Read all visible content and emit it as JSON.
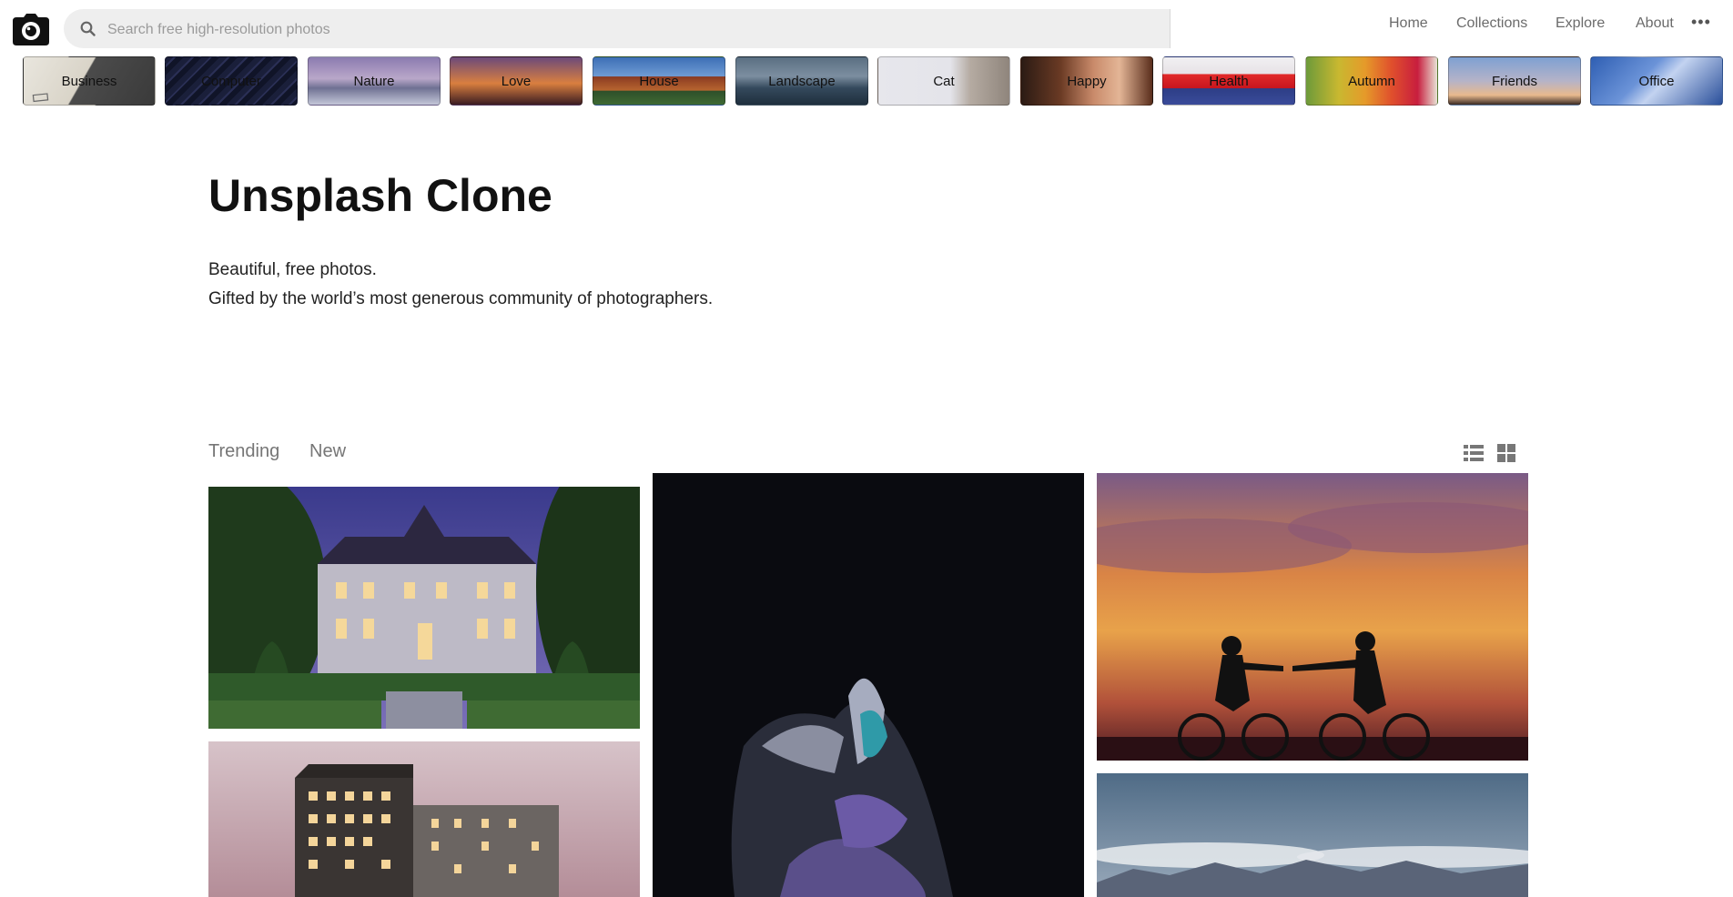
{
  "search": {
    "placeholder": "Search free high-resolution photos"
  },
  "nav": {
    "home": "Home",
    "collections": "Collections",
    "explore": "Explore",
    "about": "About",
    "more": "•••"
  },
  "topics": [
    {
      "label": "Business"
    },
    {
      "label": "Computer"
    },
    {
      "label": "Nature"
    },
    {
      "label": "Love"
    },
    {
      "label": "House"
    },
    {
      "label": "Landscape"
    },
    {
      "label": "Cat"
    },
    {
      "label": "Happy"
    },
    {
      "label": "Health"
    },
    {
      "label": "Autumn"
    },
    {
      "label": "Friends"
    },
    {
      "label": "Office"
    }
  ],
  "hero": {
    "title": "Unsplash Clone",
    "line1": "Beautiful, free photos.",
    "line2": "Gifted by the world’s most generous community of photographers."
  },
  "feed": {
    "tabs": {
      "trending": "Trending",
      "new": "New"
    },
    "view_modes": [
      "list-view-icon",
      "grid-view-icon"
    ]
  },
  "colors": {
    "search_bg": "#eeeeee",
    "nav_text": "#6b6b6b",
    "title": "#111111"
  }
}
